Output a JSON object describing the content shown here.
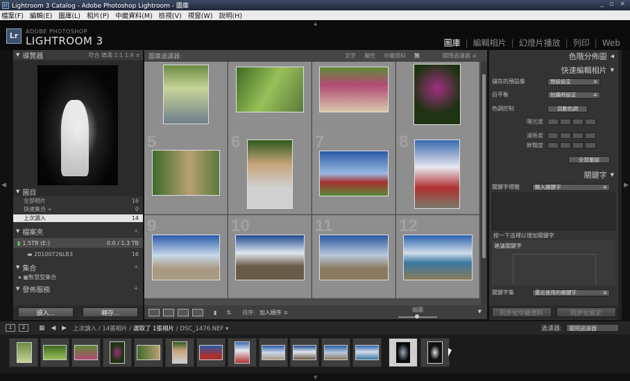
{
  "window": {
    "title": "Lightroom 3 Catalog - Adobe Photoshop Lightroom - 圖庫",
    "controls": "_ ▫ ×"
  },
  "menu": [
    "檔案(F)",
    "編輯(E)",
    "圖庫(L)",
    "相片(P)",
    "中繼資料(M)",
    "檢視(V)",
    "視窗(W)",
    "說明(H)"
  ],
  "identity": {
    "logo": "Lr",
    "line1": "ADOBE PHOTOSHOP",
    "line2": "LIGHTROOM 3"
  },
  "modules": {
    "items": [
      "圖庫",
      "編輯相片",
      "幻燈片播放",
      "列印",
      "Web"
    ],
    "active": "圖庫"
  },
  "navigator": {
    "title": "導覽器",
    "zoom": "符合  填滿  1:1  1:4 ≑"
  },
  "catalog": {
    "title": "圖目",
    "rows": [
      {
        "label": "全部相片",
        "count": "16"
      },
      {
        "label": "快速集合 +",
        "count": "0"
      },
      {
        "label": "上次讀入",
        "count": "14"
      }
    ]
  },
  "folders": {
    "title": "檔案夾",
    "volume": {
      "name": "1.5TB (E:)",
      "space": "0.0 / 1.3 TB"
    },
    "folder": {
      "name": "20100726LR3",
      "count": "16"
    }
  },
  "collections": {
    "title": "集合",
    "smart": "智慧型集合"
  },
  "publish": {
    "title": "發佈服務"
  },
  "left_buttons": {
    "import": "讀入...",
    "export": "轉存..."
  },
  "filterbar": {
    "title": "圖庫過濾器:",
    "options": [
      "文字",
      "屬性",
      "中繼資料",
      "無"
    ],
    "active": "無",
    "preset": "關閉過濾器 ≑"
  },
  "grid_numbers": [
    "",
    "",
    "",
    "",
    "5",
    "6",
    "7",
    "8",
    "9",
    "10",
    "11",
    "12"
  ],
  "toolbar": {
    "sort_label": "排序:",
    "sort_value": "加入順序 ≑",
    "thumbs": "縮圖"
  },
  "right": {
    "histogram": "色階分佈圖",
    "quick": "快速編輯相片",
    "saved_label": "儲存的預設集",
    "saved_value": "預設設定",
    "wb_label": "白平衡",
    "wb_value": "拍攝時設定",
    "tone_label": "色調控制",
    "auto": "自動色調",
    "exposure": "曝光度",
    "clarity": "清晰度",
    "vibrance": "鮮豔度",
    "reset": "全部重設",
    "keywords_title": "關鍵字",
    "kw_tags_label": "關鍵字標籤",
    "kw_tags_value": "輸入關鍵字",
    "kw_hint": "按一下這裡以增加關鍵字",
    "suggest": "建議關鍵字",
    "kw_set_label": "關鍵字集",
    "kw_set_value": "最近使用的關鍵字"
  },
  "right_buttons": {
    "sync_meta": "同步化中繼資料",
    "sync_set": "同步化設定"
  },
  "filmstrip_bar": {
    "monitors": [
      "1",
      "2"
    ],
    "source": "上次讀入 / 14張相片 / ",
    "selected": "選取了 1張相片",
    "file": " / DSC_1476.NEF ▾",
    "filter_label": "過濾器:",
    "filter_value": "關閉過濾器"
  },
  "colors": {
    "accent": "#e6e6e6",
    "panel": "#333333",
    "grid": "#8e8e8e"
  }
}
